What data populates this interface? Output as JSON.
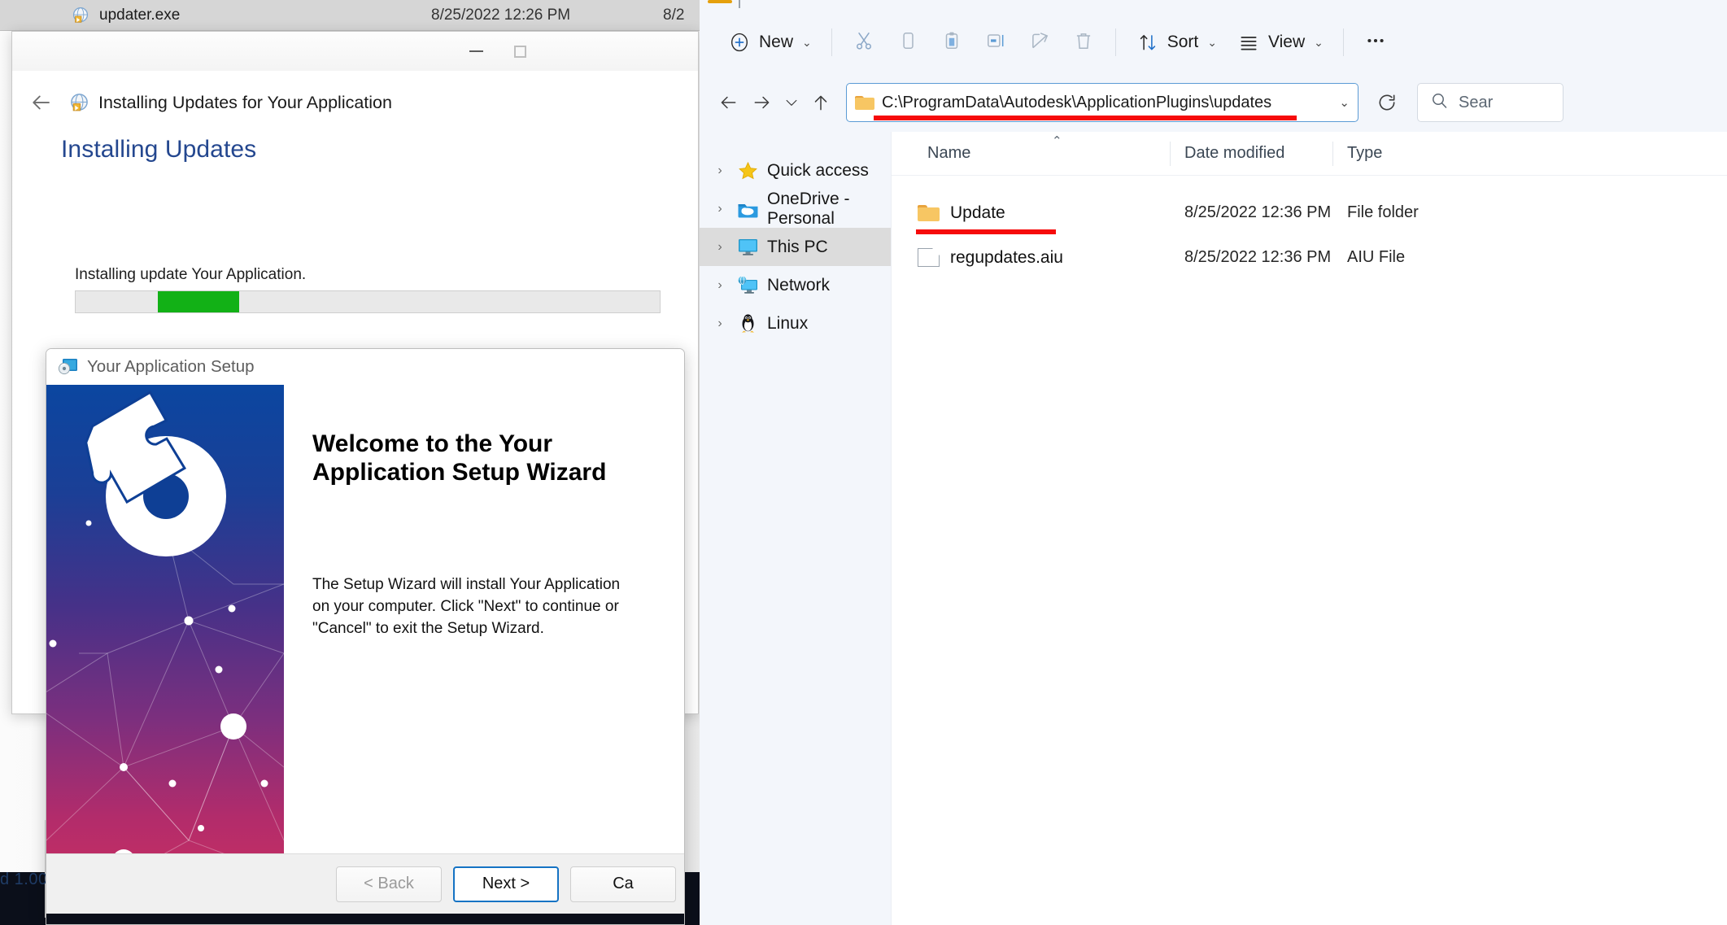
{
  "background_window": {
    "file_row": {
      "icon": "exe-globe-icon",
      "name": "updater.exe",
      "date_modified": "8/25/2022 12:26 PM",
      "date_secondary": "8/2"
    },
    "bottom_status": "d  1.00"
  },
  "updater_window": {
    "title": "Installing Updates for Your Application",
    "app_icon": "installer-globe-icon",
    "back_icon": "back-arrow-icon",
    "minimize_icon": "minimize-icon",
    "maximize_icon": "maximize-icon",
    "heading": "Installing Updates",
    "status_text": "Installing update Your Application.",
    "progress": {
      "chunk_start_percent": 14,
      "chunk_width_percent": 14,
      "accent_color": "#12b116",
      "track_color": "#e9e9e9"
    }
  },
  "setup_wizard": {
    "title": "Your Application Setup",
    "title_icon": "setup-disc-icon",
    "welcome_heading": "Welcome to the Your Application Setup Wizard",
    "paragraph": "The Setup Wizard will install Your Application on your computer.  Click \"Next\" to continue or \"Cancel\" to exit the Setup Wizard.",
    "buttons": {
      "back": "< Back",
      "next": "Next >",
      "cancel": "Ca"
    },
    "sidebar_gradient": [
      "#0b46a0",
      "#463188",
      "#c42e63"
    ]
  },
  "file_explorer": {
    "toolbar": {
      "new_label": "New",
      "new_icon": "plus-circle-icon",
      "cut_icon": "scissors-icon",
      "copy_icon": "copy-icon",
      "paste_icon": "paste-icon",
      "rename_icon": "rename-icon",
      "share_icon": "share-icon",
      "delete_icon": "trash-icon",
      "sort_label": "Sort",
      "sort_icon": "sort-arrows-icon",
      "view_label": "View",
      "view_icon": "view-lines-icon",
      "more_icon": "ellipsis-icon"
    },
    "navigation": {
      "back_icon": "arrow-left-icon",
      "forward_icon": "arrow-right-icon",
      "recent_icon": "chevron-down-icon",
      "up_icon": "arrow-up-icon",
      "refresh_icon": "refresh-icon",
      "address_value": "C:\\ProgramData\\Autodesk\\ApplicationPlugins\\updates",
      "address_folder_icon": "folder-icon",
      "address_dropdown_icon": "chevron-down-icon",
      "address_highlight_color": "#f60b0b",
      "search_placeholder": "Sear",
      "search_icon": "search-icon"
    },
    "nav_pane": [
      {
        "label": "Quick access",
        "icon": "star-icon",
        "selected": false
      },
      {
        "label": "OneDrive - Personal",
        "icon": "onedrive-icon",
        "selected": false
      },
      {
        "label": "This PC",
        "icon": "monitor-icon",
        "selected": true
      },
      {
        "label": "Network",
        "icon": "network-icon",
        "selected": false
      },
      {
        "label": "Linux",
        "icon": "penguin-icon",
        "selected": false
      }
    ],
    "columns": [
      "Name",
      "Date modified",
      "Type"
    ],
    "sort_indicator": "ascending-caret",
    "files": [
      {
        "name": "Update",
        "icon": "folder-icon",
        "date_modified": "8/25/2022 12:36 PM",
        "type": "File folder",
        "highlighted": true
      },
      {
        "name": "regupdates.aiu",
        "icon": "file-icon",
        "date_modified": "8/25/2022 12:36 PM",
        "type": "AIU File",
        "highlighted": false
      }
    ]
  }
}
